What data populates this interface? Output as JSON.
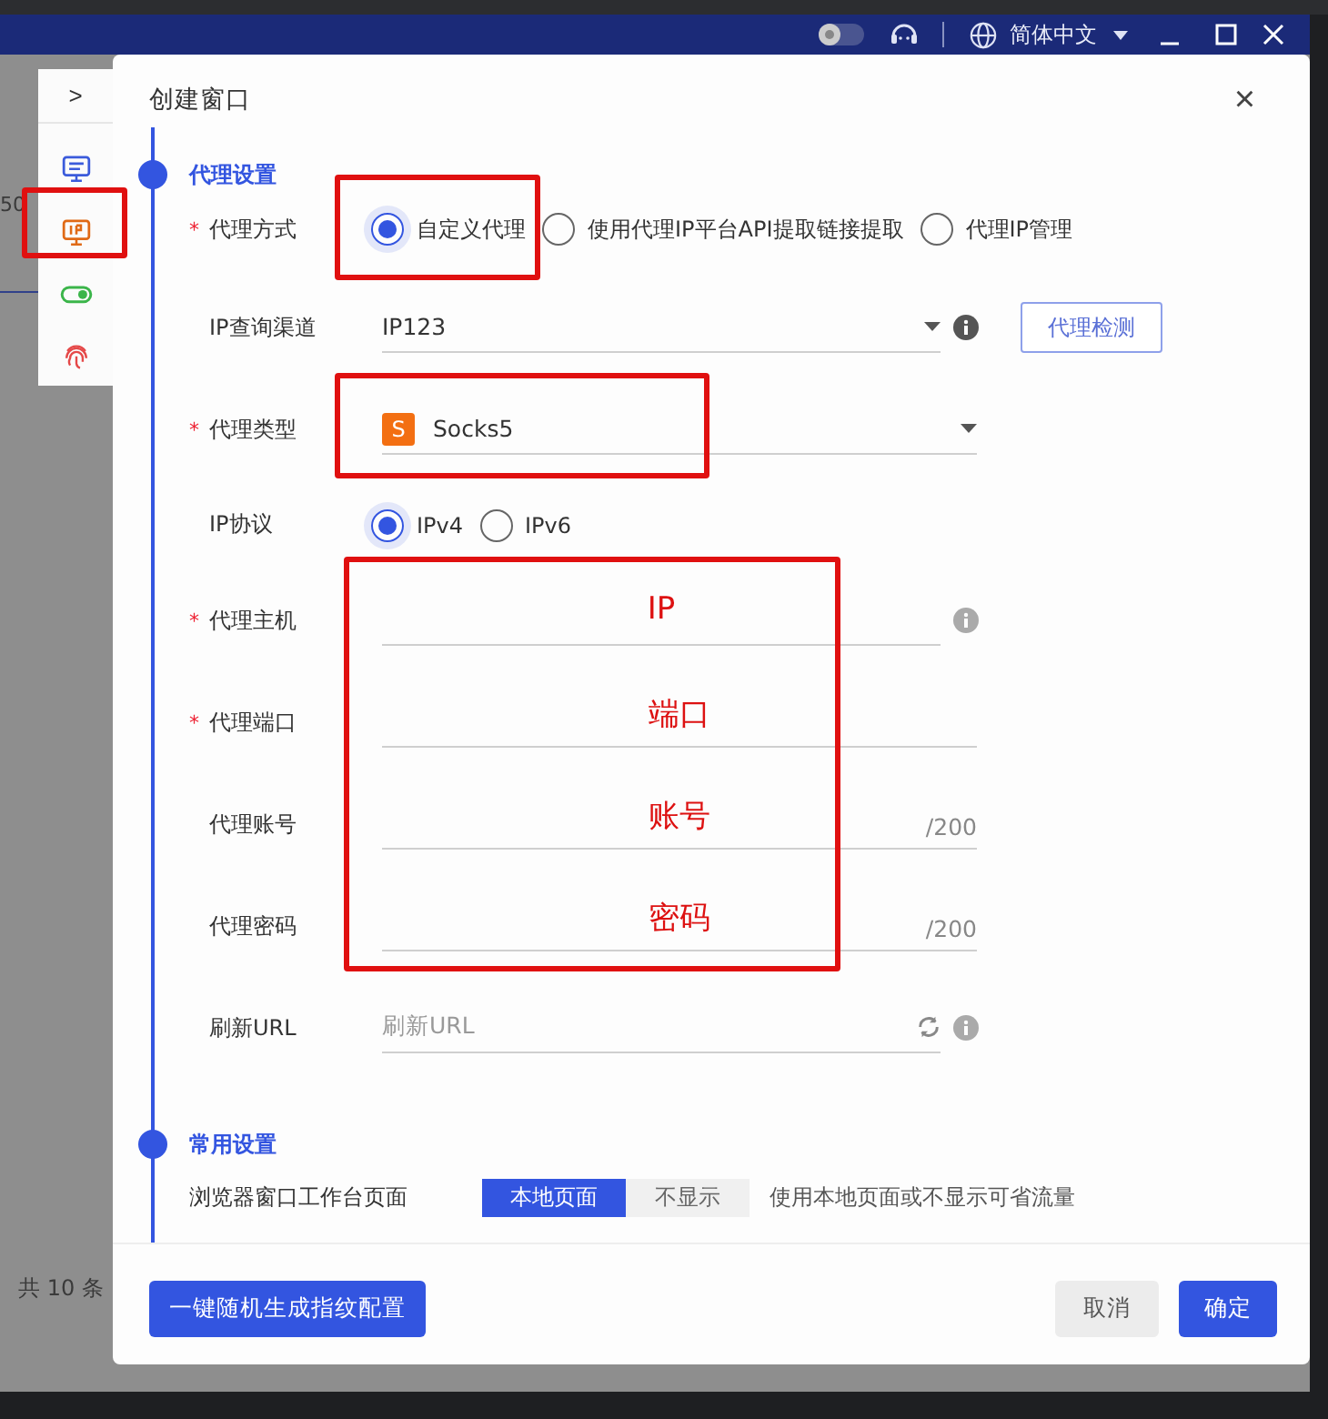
{
  "window": {
    "language": "简体中文"
  },
  "background": {
    "page_size_fragment": "50",
    "total": "共 10 条"
  },
  "sidebar": {
    "toggle": ">"
  },
  "dialog": {
    "title": "创建窗口",
    "close": "×",
    "sections": [
      {
        "title": "代理设置",
        "rows": [
          {
            "kind": "radio",
            "label": "代理方式",
            "required_mark": "*",
            "options": [
              {
                "label": "自定义代理",
                "selected": true
              },
              {
                "label": "使用代理IP平台API提取链接提取",
                "selected": false
              },
              {
                "label": "代理IP管理",
                "selected": false
              }
            ]
          },
          {
            "kind": "select",
            "label": "IP查询渠道",
            "value": "IP123",
            "info": true,
            "button": "代理检测"
          },
          {
            "kind": "select",
            "label": "代理类型",
            "required_mark": "*",
            "badge": "S",
            "value": "Socks5"
          },
          {
            "kind": "radio",
            "label": "IP协议",
            "options": [
              {
                "label": "IPv4",
                "selected": true
              },
              {
                "label": "IPv6",
                "selected": false
              }
            ]
          },
          {
            "kind": "input",
            "label": "代理主机",
            "required_mark": "*",
            "annotation": "IP",
            "info": true
          },
          {
            "kind": "input",
            "label": "代理端口",
            "required_mark": "*",
            "annotation": "端口"
          },
          {
            "kind": "input",
            "label": "代理账号",
            "annotation": "账号",
            "counter": "/200"
          },
          {
            "kind": "input",
            "label": "代理密码",
            "annotation": "密码",
            "counter": "/200"
          },
          {
            "kind": "input",
            "label": "刷新URL",
            "placeholder": "刷新URL",
            "refresh": true,
            "info": true
          }
        ]
      },
      {
        "title": "常用设置",
        "rows": [
          {
            "kind": "segmented",
            "label": "浏览器窗口工作台页面",
            "options": [
              {
                "label": "本地页面",
                "selected": true
              },
              {
                "label": "不显示",
                "selected": false
              }
            ],
            "hint": "使用本地页面或不显示可省流量"
          }
        ]
      }
    ],
    "footer": {
      "generate_button": "一键随机生成指纹配置",
      "cancel_button": "取消",
      "ok_button": "确定"
    }
  }
}
